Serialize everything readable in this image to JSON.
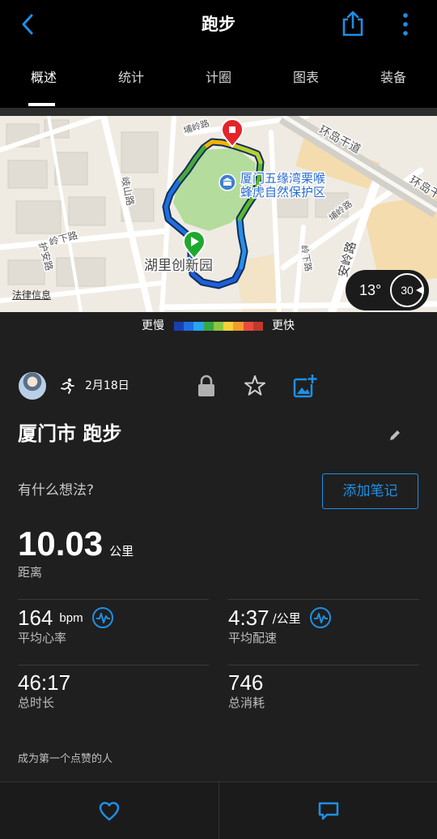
{
  "header": {
    "title": "跑步"
  },
  "icons": {
    "back": "chevron-left-icon",
    "share": "share-icon",
    "more": "more-vertical-icon",
    "lock": "lock-icon",
    "favorite": "star-icon",
    "add_photo": "add-photo-icon",
    "edit": "pencil-icon",
    "like": "heart-icon",
    "comment": "comment-icon"
  },
  "tabs": [
    {
      "label": "概述",
      "active": true
    },
    {
      "label": "统计",
      "active": false
    },
    {
      "label": "计圈",
      "active": false
    },
    {
      "label": "图表",
      "active": false
    },
    {
      "label": "装备",
      "active": false
    }
  ],
  "map": {
    "labels": {
      "ring_road": "环岛干道",
      "ring_road_edge": "环岛干",
      "reserve_line1": "厦门五缘湾栗喉",
      "reserve_line2": "蜂虎自然保护区",
      "park": "湖里创新园",
      "qishan_rd": "岐山路",
      "lingxia_rd_left": "岭下路",
      "huan_rd": "护安路",
      "anling_rd": "安岭路",
      "puling_rd_top": "埔岭路",
      "puling_rd_right": "埔岭路",
      "lingxia_rd_right": "岭下路"
    },
    "legal_link": "法律信息",
    "weather": {
      "temperature": "13°",
      "wind_speed": "30"
    }
  },
  "pace_legend": {
    "slower": "更慢",
    "faster": "更快",
    "colors": [
      "#1a3fb0",
      "#1f6fe0",
      "#2aa5ef",
      "#36a845",
      "#8cc63f",
      "#f4d03a",
      "#f39c2b",
      "#e74c3c",
      "#c0392b"
    ]
  },
  "activity": {
    "date": "2月18日",
    "title": "厦门市 跑步",
    "note_prompt": "有什么想法?",
    "add_note_label": "添加笔记"
  },
  "stats": {
    "distance": {
      "value": "10.03",
      "unit": "公里",
      "label": "距离"
    },
    "avg_heart_rate": {
      "value": "164",
      "unit": "bpm",
      "label": "平均心率"
    },
    "avg_pace": {
      "value": "4:37",
      "unit": "/公里",
      "label": "平均配速"
    },
    "total_time": {
      "value": "46:17",
      "label": "总时长"
    },
    "calories": {
      "value": "746",
      "label": "总消耗"
    }
  },
  "social": {
    "likes_prompt": "成为第一个点赞的人"
  },
  "colors": {
    "accent": "#1f8fe5",
    "background": "#1f1f1f",
    "header": "#000000"
  }
}
